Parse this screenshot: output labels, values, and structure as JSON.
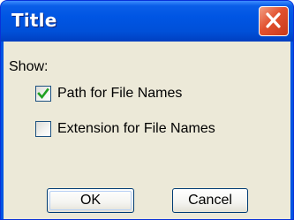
{
  "window": {
    "title": "Title"
  },
  "titlebar": {
    "close_icon": "close-icon"
  },
  "options": {
    "group_label": "Show:",
    "items": [
      {
        "label": "Path for File Names",
        "checked": true
      },
      {
        "label": "Extension for File Names",
        "checked": false
      }
    ]
  },
  "buttons": {
    "ok_label": "OK",
    "cancel_label": "Cancel"
  },
  "colors": {
    "titlebar": "#0055e3",
    "close_button": "#e2512f",
    "client_bg": "#ece9d8",
    "checkmark": "#21a121"
  }
}
